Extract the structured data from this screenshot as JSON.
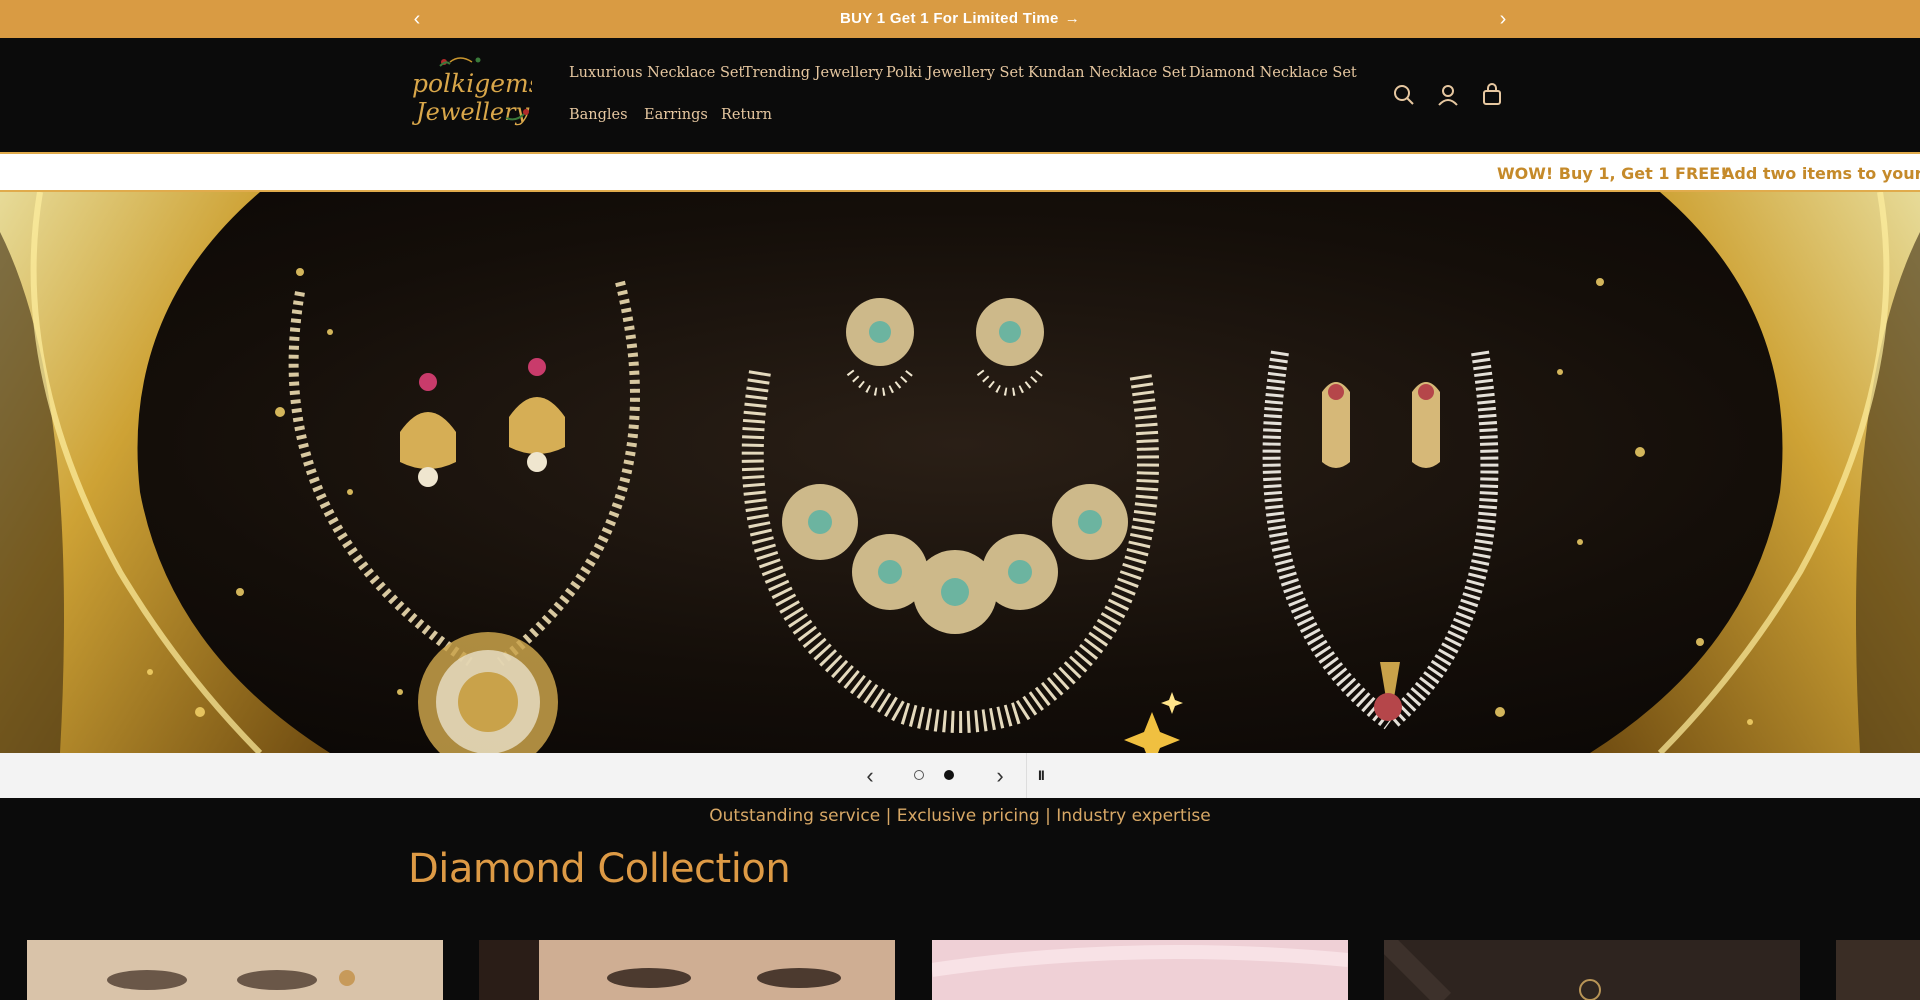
{
  "announcement": {
    "text": "BUY 1 Get 1 For Limited Time",
    "arrow": "→",
    "prev_icon": "‹",
    "next_icon": "›"
  },
  "header": {
    "logo_line1": "polkigems",
    "logo_line2": "Jewellery",
    "nav": [
      "Luxurious Necklace Set",
      "Trending Jewellery",
      "Polki Jewellery Set",
      "Kundan Necklace Set",
      "Diamond Necklace Set",
      "Bangles",
      "Earrings",
      "Return"
    ],
    "icons": [
      "search-icon",
      "account-icon",
      "cart-icon"
    ]
  },
  "marquee": {
    "items": [
      "WOW! Buy 1, Get 1 FREE!",
      "Add two items to your cart"
    ]
  },
  "slider": {
    "prev_icon": "‹",
    "next_icon": "›",
    "pause_icon": "II",
    "slide_count": 2,
    "active_slide": 2
  },
  "tagline": "Outstanding service | Exclusive pricing | Industry expertise",
  "collection": {
    "title": "Diamond Collection"
  },
  "colors": {
    "announcement_bg": "#d99b43",
    "header_bg": "#0b0b0b",
    "nav_text": "#e6c7a0",
    "accent": "#dd9a45",
    "marquee_text": "#c58a2a"
  }
}
